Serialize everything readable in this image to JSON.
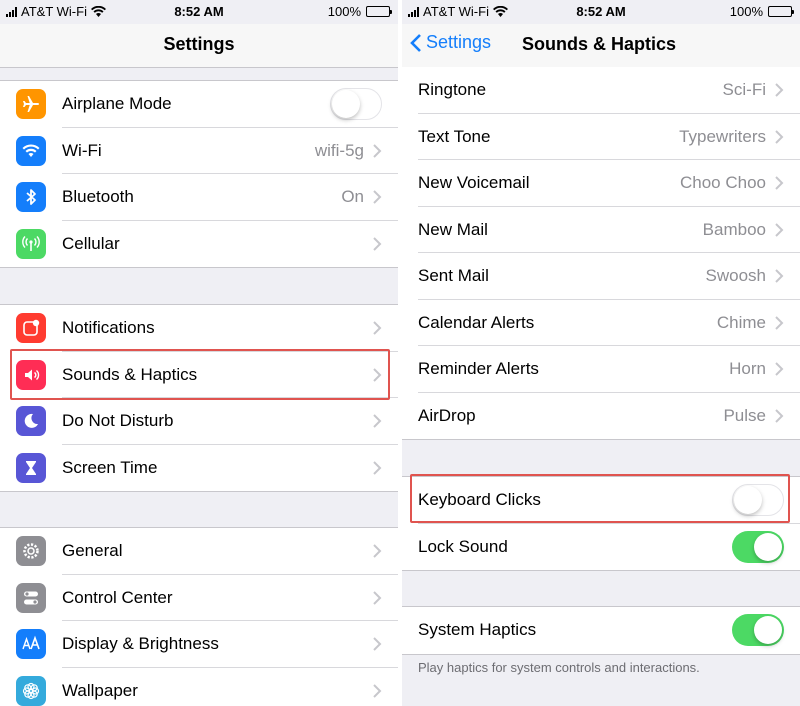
{
  "status_left": {
    "carrier": "AT&T Wi-Fi",
    "time": "8:52 AM",
    "battery": "100%"
  },
  "status_right": {
    "carrier": "AT&T Wi-Fi",
    "time": "8:52 AM",
    "battery": "100%"
  },
  "settings": {
    "title": "Settings",
    "group1": [
      {
        "label": "Airplane Mode",
        "icon": "airplane-icon",
        "color": "#ff9500",
        "toggle": "off"
      },
      {
        "label": "Wi-Fi",
        "icon": "wifi-icon",
        "color": "#147efb",
        "value": "wifi-5g"
      },
      {
        "label": "Bluetooth",
        "icon": "bluetooth-icon",
        "color": "#147efb",
        "value": "On"
      },
      {
        "label": "Cellular",
        "icon": "cellular-icon",
        "color": "#4cd964",
        "value": ""
      }
    ],
    "group2": [
      {
        "label": "Notifications",
        "icon": "notifications-icon",
        "color": "#ff3b30"
      },
      {
        "label": "Sounds & Haptics",
        "icon": "speaker-icon",
        "color": "#ff2d55"
      },
      {
        "label": "Do Not Disturb",
        "icon": "moon-icon",
        "color": "#5856d6"
      },
      {
        "label": "Screen Time",
        "icon": "hourglass-icon",
        "color": "#5856d6"
      }
    ],
    "group3": [
      {
        "label": "General",
        "icon": "gear-icon",
        "color": "#8e8e93"
      },
      {
        "label": "Control Center",
        "icon": "switches-icon",
        "color": "#8e8e93"
      },
      {
        "label": "Display & Brightness",
        "icon": "text-size-icon",
        "color": "#147efb"
      },
      {
        "label": "Wallpaper",
        "icon": "flower-icon",
        "color": "#34aadc"
      }
    ]
  },
  "sounds": {
    "back_label": "Settings",
    "title": "Sounds & Haptics",
    "tones": [
      {
        "label": "Ringtone",
        "value": "Sci-Fi"
      },
      {
        "label": "Text Tone",
        "value": "Typewriters"
      },
      {
        "label": "New Voicemail",
        "value": "Choo Choo"
      },
      {
        "label": "New Mail",
        "value": "Bamboo"
      },
      {
        "label": "Sent Mail",
        "value": "Swoosh"
      },
      {
        "label": "Calendar Alerts",
        "value": "Chime"
      },
      {
        "label": "Reminder Alerts",
        "value": "Horn"
      },
      {
        "label": "AirDrop",
        "value": "Pulse"
      }
    ],
    "keyboard_clicks": {
      "label": "Keyboard Clicks",
      "state": "off"
    },
    "lock_sound": {
      "label": "Lock Sound",
      "state": "on"
    },
    "system_haptics": {
      "label": "System Haptics",
      "state": "on"
    },
    "haptics_note": "Play haptics for system controls and interactions."
  },
  "colors": {
    "accent": "#147efb",
    "toggle_on": "#4cd964",
    "highlight": "#e0544f"
  }
}
